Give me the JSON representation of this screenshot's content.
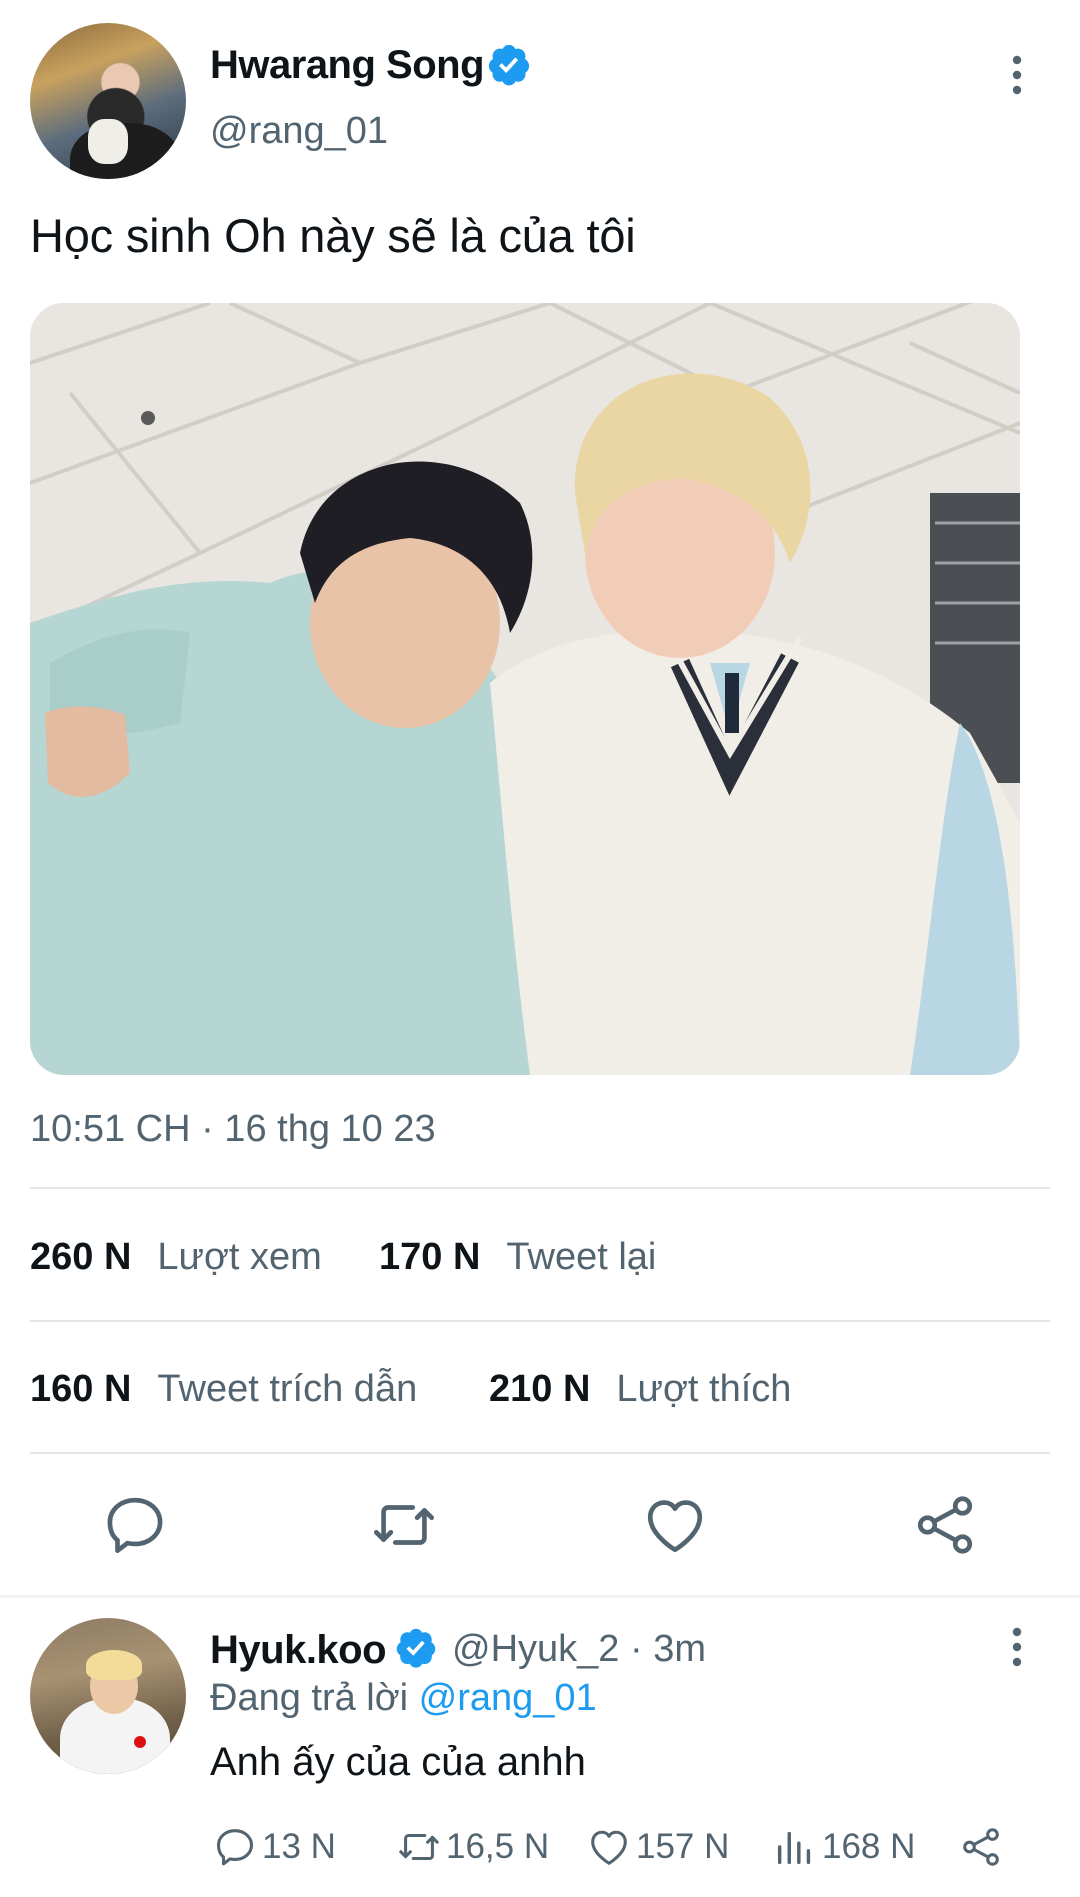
{
  "tweet": {
    "author_name": "Hwarang Song",
    "author_handle": "@rang_01",
    "text": "Học sinh Oh này sẽ là của tôi",
    "timestamp": "10:51 CH · 16 thg 10 23",
    "stats": {
      "views_count": "260 N",
      "views_label": "Lượt xem",
      "retweets_count": "170 N",
      "retweets_label": "Tweet lại",
      "quotes_count": "160 N",
      "quotes_label": "Tweet trích dẫn",
      "likes_count": "210 N",
      "likes_label": "Lượt thích"
    },
    "actions": [
      "comment-icon",
      "retweet-icon",
      "heart-icon",
      "share-icon"
    ]
  },
  "reply": {
    "author_name": "Hyuk.koo",
    "author_handle": "@Hyuk_2",
    "time": "· 3m",
    "replying_prefix": "Đang trả lời",
    "replying_mention": "@rang_01",
    "text": "Anh ấy của của anhh",
    "counts": {
      "replies": "13 N",
      "retweets": "16,5 N",
      "likes": "157 N",
      "views": "168 N"
    }
  },
  "colors": {
    "verified": "#1d9bf0",
    "link": "#1d9bf0",
    "secondary_text": "#536471",
    "primary_text": "#0f1419",
    "divider": "#e3e6e8"
  }
}
